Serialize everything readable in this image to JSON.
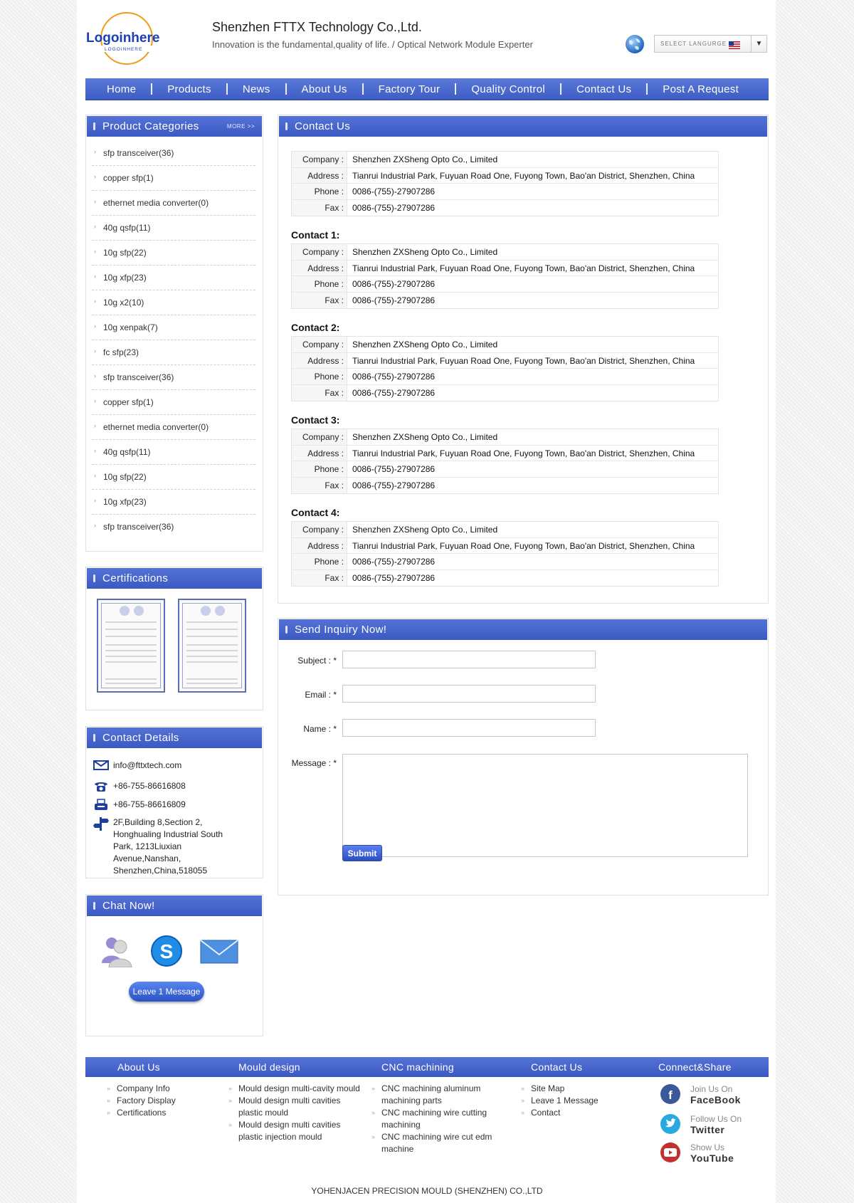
{
  "header": {
    "logo_text": "Logoinhere",
    "logo_subtext": "LOGOINHERE",
    "title": "Shenzhen FTTX Technology Co.,Ltd.",
    "slogan": "Innovation is the fundamental,quality of life. / Optical Network Module Experter",
    "language_label": "SELECT LANGURGE",
    "language_flag_icon": "us-flag-icon",
    "globe_icon": "globe-icon"
  },
  "nav": [
    {
      "label": "Home"
    },
    {
      "label": "Products"
    },
    {
      "label": "News"
    },
    {
      "label": "About Us"
    },
    {
      "label": "Factory Tour"
    },
    {
      "label": "Quality Control"
    },
    {
      "label": "Contact Us"
    },
    {
      "label": "Post A Request"
    }
  ],
  "sidebar": {
    "categories_title": "Product Categories",
    "more_label": "MORE >>",
    "categories": [
      "sfp transceiver(36)",
      "copper sfp(1)",
      "ethernet media converter(0)",
      "40g qsfp(11)",
      "10g sfp(22)",
      "10g xfp(23)",
      "10g x2(10)",
      "10g xenpak(7)",
      "fc sfp(23)",
      "sfp transceiver(36)",
      "copper sfp(1)",
      "ethernet media converter(0)",
      "40g qsfp(11)",
      "10g sfp(22)",
      "10g xfp(23)",
      "sfp transceiver(36)"
    ],
    "certifications_title": "Certifications",
    "contact_details_title": "Contact Details",
    "contact_details": {
      "email": "info@fttxtech.com",
      "phone": "+86-755-86616808",
      "fax": "+86-755-86616809",
      "address": "2F,Building 8,Section 2, Honghualing Industrial South Park, 1213Liuxian Avenue,Nanshan, Shenzhen,China,518055"
    },
    "chat_title": "Chat Now!",
    "chat_icons": [
      "messenger-icon",
      "skype-icon",
      "mail-icon"
    ],
    "leave_message_label": "Leave 1 Message"
  },
  "contact": {
    "title": "Contact Us",
    "labels": {
      "company": "Company :",
      "address": "Address :",
      "phone": "Phone :",
      "fax": "Fax :"
    },
    "main": {
      "company": "Shenzhen ZXSheng Opto Co., Limited",
      "address": "Tianrui Industrial Park, Fuyuan Road One, Fuyong Town, Bao'an District, Shenzhen, China",
      "phone": "0086-(755)-27907286",
      "fax": "0086-(755)-27907286"
    },
    "contacts": [
      {
        "title": "Contact 1:",
        "company": "Shenzhen ZXSheng Opto Co., Limited",
        "address": "Tianrui Industrial Park, Fuyuan Road One, Fuyong Town, Bao'an District, Shenzhen, China",
        "phone": "0086-(755)-27907286",
        "fax": "0086-(755)-27907286"
      },
      {
        "title": "Contact 2:",
        "company": "Shenzhen ZXSheng Opto Co., Limited",
        "address": "Tianrui Industrial Park, Fuyuan Road One, Fuyong Town, Bao'an District, Shenzhen, China",
        "phone": "0086-(755)-27907286",
        "fax": "0086-(755)-27907286"
      },
      {
        "title": "Contact 3:",
        "company": "Shenzhen ZXSheng Opto Co., Limited",
        "address": "Tianrui Industrial Park, Fuyuan Road One, Fuyong Town, Bao'an District, Shenzhen, China",
        "phone": "0086-(755)-27907286",
        "fax": "0086-(755)-27907286"
      },
      {
        "title": "Contact 4:",
        "company": "Shenzhen ZXSheng Opto Co., Limited",
        "address": "Tianrui Industrial Park, Fuyuan Road One, Fuyong Town, Bao'an District, Shenzhen, China",
        "phone": "0086-(755)-27907286",
        "fax": "0086-(755)-27907286"
      }
    ]
  },
  "inquiry": {
    "title": "Send Inquiry Now!",
    "subject_label": "Subject : *",
    "email_label": "Email : *",
    "name_label": "Name : *",
    "message_label": "Message : *",
    "subject_value": "",
    "email_value": "",
    "name_value": "",
    "message_value": "",
    "submit_label": "Submit"
  },
  "footer": {
    "about": {
      "title": "About Us",
      "links": [
        "Company Info",
        "Factory Display",
        "Certifications"
      ]
    },
    "mould": {
      "title": "Mould design",
      "links": [
        "Mould design multi-cavity mould",
        "Mould design multi cavities plastic mould",
        "Mould design multi cavities plastic injection mould"
      ]
    },
    "cnc": {
      "title": "CNC machining",
      "links": [
        "CNC machining aluminum machining parts",
        "CNC machining wire cutting machining",
        "CNC machining wire cut edm machine"
      ]
    },
    "contact": {
      "title": "Contact Us",
      "links": [
        "Site Map",
        "Leave 1 Message",
        "Contact"
      ]
    },
    "connect": {
      "title": "Connect&Share",
      "items": [
        {
          "line1": "Join Us On",
          "line2": "FaceBook",
          "icon": "facebook-icon",
          "color": "#3b5998"
        },
        {
          "line1": "Follow Us On",
          "line2": "Twitter",
          "icon": "twitter-icon",
          "color": "#2aa9e0"
        },
        {
          "line1": "Show Us",
          "line2": "YouTube",
          "icon": "youtube-icon",
          "color": "#c4302b"
        }
      ]
    },
    "copyright": "YOHENJACEN PRECISION MOULD (SHENZHEN) CO.,LTD"
  },
  "colors": {
    "accent": "#3f5ec8",
    "panel_border": "#e0e0e0"
  }
}
